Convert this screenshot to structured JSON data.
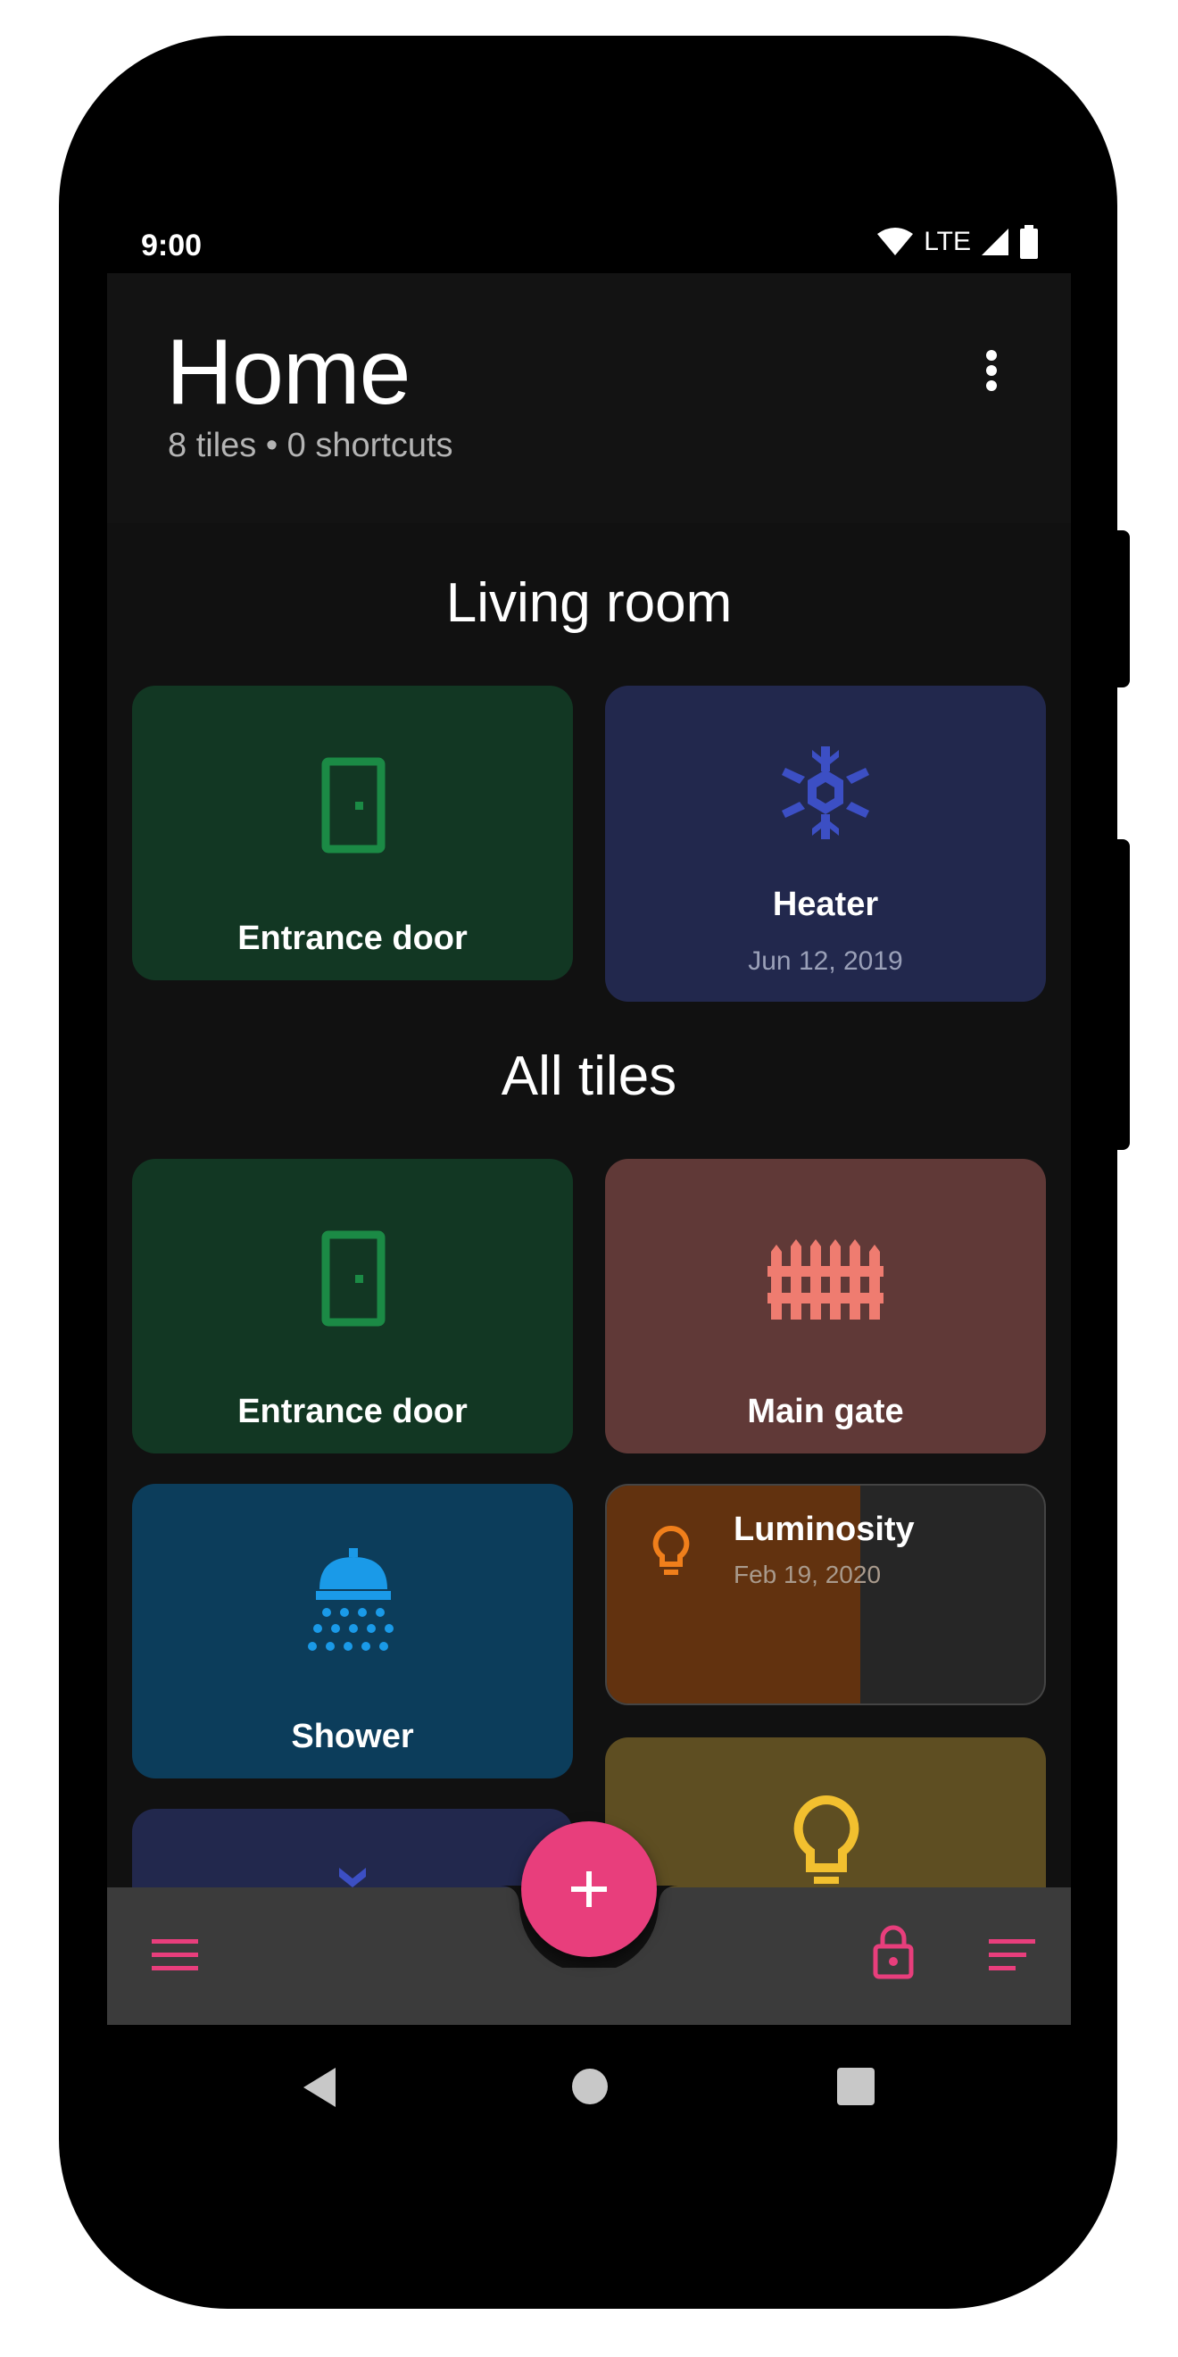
{
  "status": {
    "time": "9:00",
    "network": "LTE"
  },
  "header": {
    "title": "Home",
    "subtitle": "8 tiles • 0 shortcuts"
  },
  "sections": [
    {
      "title": "Living room"
    },
    {
      "title": "All tiles"
    }
  ],
  "living_room": [
    {
      "label": "Entrance door",
      "icon": "door-icon",
      "color": "#123723",
      "icon_color": "#1b8a45"
    },
    {
      "label": "Heater",
      "date": "Jun 12, 2019",
      "icon": "snowflake-icon",
      "color": "#22284d",
      "icon_color": "#3c4fc4"
    }
  ],
  "all_tiles": [
    {
      "label": "Entrance door",
      "icon": "door-icon",
      "color": "#123723",
      "icon_color": "#1b8a45"
    },
    {
      "label": "Main gate",
      "icon": "fence-icon",
      "color": "#603937",
      "icon_color": "#ef7c70"
    },
    {
      "label": "Shower",
      "icon": "shower-icon",
      "color": "#0c3d5b",
      "icon_color": "#1a9ae8"
    },
    {
      "label": "Luminosity",
      "date": "Feb 19, 2020",
      "icon": "lightbulb-icon",
      "color": "#62320f",
      "icon_color": "#f07f1b",
      "level": 0.58
    },
    {
      "label": "",
      "icon": "snowflake-icon",
      "color": "#22284d"
    },
    {
      "label": "",
      "icon": "lightbulb-icon",
      "color": "#5e4e22",
      "icon_color": "#f2c02f"
    }
  ],
  "bottom_bar": {
    "menu_icon": "menu-icon",
    "lock_icon": "lock-icon",
    "sort_icon": "sort-icon",
    "accent": "#e83e7c"
  },
  "fab": {
    "icon": "plus-icon",
    "color": "#e83e7c"
  },
  "navbar": {
    "back": "back-icon",
    "home": "home-icon",
    "recents": "recents-icon"
  }
}
